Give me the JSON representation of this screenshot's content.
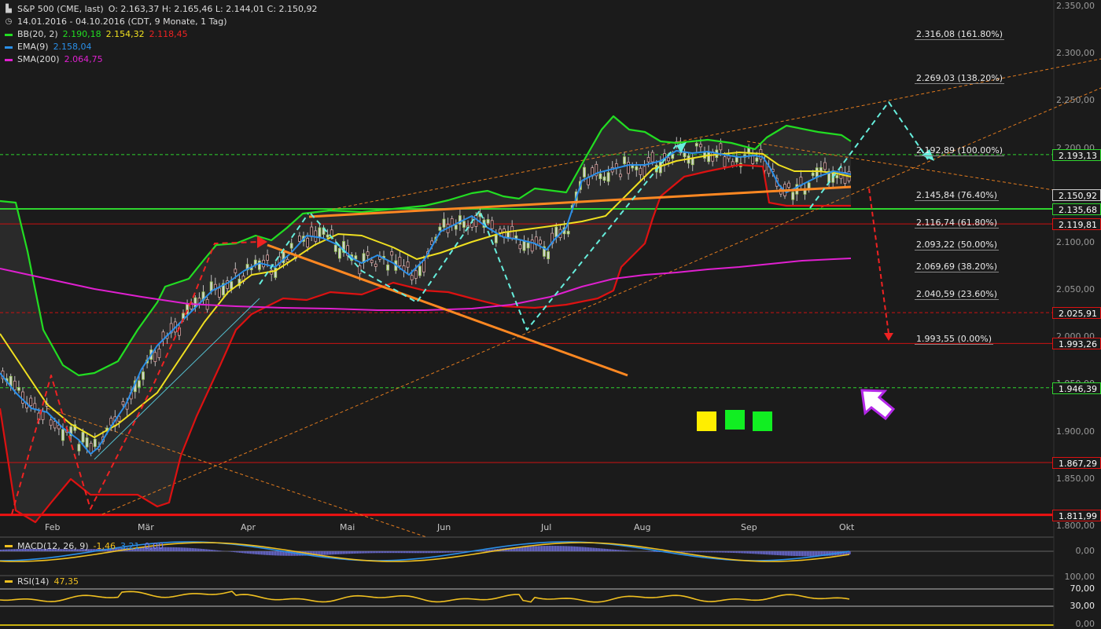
{
  "header": {
    "symbol": "S&P 500 (CME, last)",
    "ohlc": "O: 2.163,37  H: 2.165,46  L: 2.144,01  C: 2.150,92",
    "range": "14.01.2016 - 04.10.2016 (CDT, 9 Monate, 1 Tag)"
  },
  "indicators": {
    "bb": {
      "label": "BB(20, 2)",
      "v1": "2.190,18",
      "v2": "2.154,32",
      "v3": "2.118,45"
    },
    "ema": {
      "label": "EMA(9)",
      "v1": "2.158,04"
    },
    "sma": {
      "label": "SMA(200)",
      "v1": "2.064,75"
    },
    "macd": {
      "label": "MACD(12, 26, 9)",
      "v1": "-1,46",
      "v2": "3,21",
      "v3": "0,00"
    },
    "rsi": {
      "label": "RSI(14)",
      "v1": "47,35"
    }
  },
  "fib_levels": [
    {
      "label": "2.316,08 (161.80%)",
      "value": 2316.08
    },
    {
      "label": "2.269,03 (138.20%)",
      "value": 2269.03
    },
    {
      "label": "2.192,89 (100.00%)",
      "value": 2192.89
    },
    {
      "label": "2.145,84 (76.40%)",
      "value": 2145.84
    },
    {
      "label": "2.116,74 (61.80%)",
      "value": 2116.74
    },
    {
      "label": "2.093,22 (50.00%)",
      "value": 2093.22
    },
    {
      "label": "2.069,69 (38.20%)",
      "value": 2069.69
    },
    {
      "label": "2.040,59 (23.60%)",
      "value": 2040.59
    },
    {
      "label": "1.993,55 (0.00%)",
      "value": 1993.55
    }
  ],
  "price_tags": [
    {
      "label": "2.193,13",
      "value": 2193.13,
      "bg": "#1b1b1b",
      "fg": "#ffffff",
      "border": "#2fd52f"
    },
    {
      "label": "2.150,92",
      "value": 2150.92,
      "bg": "#1b1b1b",
      "fg": "#ffffff",
      "border": "#cccccc"
    },
    {
      "label": "2.135,68",
      "value": 2135.68,
      "bg": "#1b1b1b",
      "fg": "#ffffff",
      "border": "#2fd52f"
    },
    {
      "label": "2.119,81",
      "value": 2119.81,
      "bg": "#1b1b1b",
      "fg": "#ffffff",
      "border": "#d11"
    },
    {
      "label": "2.025,91",
      "value": 2025.91,
      "bg": "#1b1b1b",
      "fg": "#ffffff",
      "border": "#d11"
    },
    {
      "label": "1.993,26",
      "value": 1993.26,
      "bg": "#1b1b1b",
      "fg": "#ffffff",
      "border": "#d11"
    },
    {
      "label": "1.946,39",
      "value": 1946.39,
      "bg": "#1b1b1b",
      "fg": "#ffffff",
      "border": "#2fd52f"
    },
    {
      "label": "1.867,29",
      "value": 1867.29,
      "bg": "#1b1b1b",
      "fg": "#ffffff",
      "border": "#d11"
    },
    {
      "label": "1.811,99",
      "value": 1811.99,
      "bg": "#1b1b1b",
      "fg": "#ffffff",
      "border": "#d11"
    }
  ],
  "y_axis_ticks": [
    "2.350,00",
    "2.300,00",
    "2.250,00",
    "2.200,00",
    "2.150,00",
    "2.100,00",
    "2.050,00",
    "2.000,00",
    "1.950,00",
    "1.900,00",
    "1.850,00",
    "1.800,00"
  ],
  "macd_axis": "0,00",
  "rsi_axis": [
    "100,00",
    "70,00",
    "30,00",
    "0,00"
  ],
  "months": [
    "Feb",
    "Mär",
    "Apr",
    "Mai",
    "Jun",
    "Jul",
    "Aug",
    "Sep",
    "Okt"
  ],
  "colors": {
    "bb_upper": "#22dd22",
    "bb_mid": "#f0e020",
    "bb_lower": "#dd1111",
    "ema": "#2a8fe8",
    "sma": "#e020d0",
    "candle": "#cfcfcf",
    "trend": "#ff8822",
    "cyan": "#66eedd",
    "accent_arrow": "#b428e8"
  },
  "chart_data": {
    "type": "line",
    "title": "S&P 500 (CME, last)",
    "x": [
      "Feb",
      "Mär",
      "Apr",
      "Mai",
      "Jun",
      "Jul",
      "Aug",
      "Sep",
      "Okt"
    ],
    "ylim": [
      1800,
      2350
    ],
    "series": [
      {
        "name": "S&P 500",
        "values": [
          1890,
          1935,
          2050,
          2070,
          2090,
          2060,
          2170,
          2180,
          2150
        ]
      },
      {
        "name": "BB(20, 2)",
        "values": [
          1900,
          1960,
          2080,
          2100,
          2120,
          2100,
          2200,
          2190,
          2190
        ]
      },
      {
        "name": "EMA(9)",
        "values": [
          1890,
          1930,
          2045,
          2075,
          2090,
          2080,
          2165,
          2180,
          2158
        ]
      },
      {
        "name": "SMA(200)",
        "values": [
          2055,
          2035,
          2015,
          2010,
          2010,
          2010,
          2030,
          2050,
          2065
        ]
      }
    ]
  }
}
